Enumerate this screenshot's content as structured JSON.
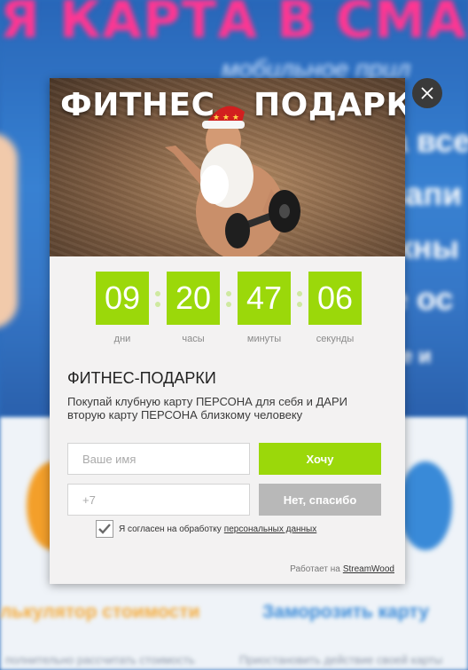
{
  "background": {
    "headline": "Я КАРТА В СМАР",
    "subline": "мобильное прил",
    "side_texts": [
      "а все",
      "запи",
      "жны",
      "е ос",
      "ке и"
    ],
    "bottom_left": "лькулятор стоимости",
    "bottom_right": "Заморозить карту",
    "bottom_left_small": "полнительно рассчитать стоимость",
    "bottom_right_small": "Приостановить действие своей карты"
  },
  "banner": {
    "title_left": "ФИТНЕС",
    "title_right": "ПОДАРКИ"
  },
  "countdown": [
    {
      "value": "09",
      "label": "дни"
    },
    {
      "value": "20",
      "label": "часы"
    },
    {
      "value": "47",
      "label": "минуты"
    },
    {
      "value": "06",
      "label": "секунды"
    }
  ],
  "form": {
    "title": "ФИТНЕС-ПОДАРКИ",
    "description": "Покупай клубную карту ПЕРСОНА для себя и ДАРИ вторую карту ПЕРСОНА близкому человеку",
    "name_placeholder": "Ваше имя",
    "phone_placeholder": "+7",
    "want_button": "Хочу",
    "no_button": "Нет, спасибо",
    "consent_text": "Я согласен на обработку",
    "consent_link": "персональных данных",
    "consent_checked": true
  },
  "footer": {
    "powered_text": "Работает на",
    "powered_link": "StreamWood"
  },
  "colors": {
    "accent_green": "#9bd80a",
    "muted_button": "#b8b8b8",
    "background_blue": "#1f64b8",
    "headline_pink": "#ff2a8c"
  },
  "icons": {
    "close": "close-icon",
    "check": "check-icon"
  }
}
